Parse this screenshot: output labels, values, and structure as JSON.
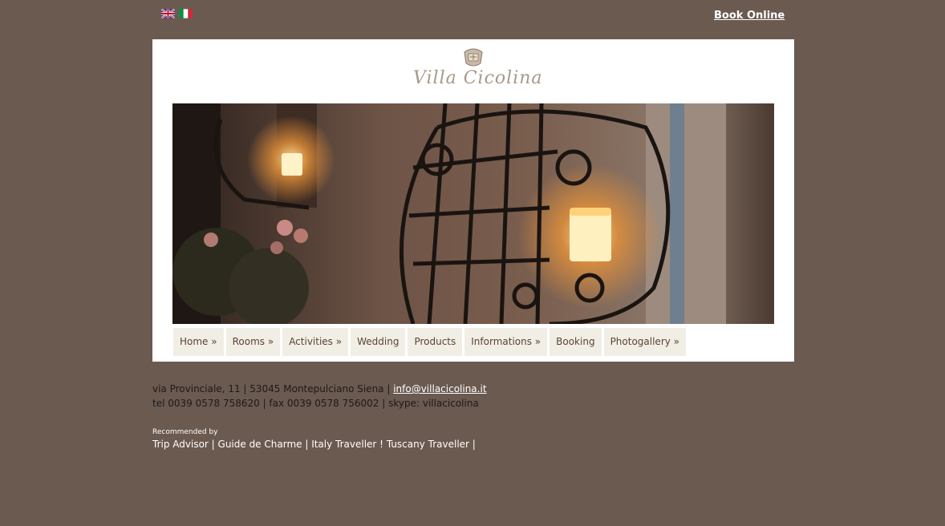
{
  "header": {
    "languages": [
      {
        "name": "uk-flag-icon",
        "label": "English"
      },
      {
        "name": "italy-flag-icon",
        "label": "Italiano"
      }
    ],
    "book_online": "Book Online"
  },
  "logo": {
    "text": "Villa Cicolina",
    "icon": "crest-icon"
  },
  "hero": {
    "icon": "candle-window-photo"
  },
  "nav": {
    "items": [
      {
        "label": "Home »"
      },
      {
        "label": "Rooms »"
      },
      {
        "label": "Activities »"
      },
      {
        "label": "Wedding"
      },
      {
        "label": "Products"
      },
      {
        "label": "Informations »"
      },
      {
        "label": "Booking"
      },
      {
        "label": "Photogallery »"
      }
    ]
  },
  "footer": {
    "address": "via Provinciale, 11 | 53045 Montepulciano Siena | ",
    "email": "info@villacicolina.it",
    "contacts": "tel 0039 0578 758620 | fax 0039 0578 756002 | skype: villacicolina",
    "recommended_label": "Recommended by",
    "recommended": [
      {
        "label": "Trip Advisor",
        "sep": " | "
      },
      {
        "label": "Guide de Charme",
        "sep": " | "
      },
      {
        "label": "Italy Traveller",
        "sep": " ! "
      },
      {
        "label": "Tuscany Traveller",
        "sep": " |"
      }
    ]
  },
  "colors": {
    "background": "#6b5a50",
    "panel": "#ffffff",
    "nav_bg": "#f1eee5",
    "nav_text": "#5b4434",
    "logo": "#a89888"
  }
}
